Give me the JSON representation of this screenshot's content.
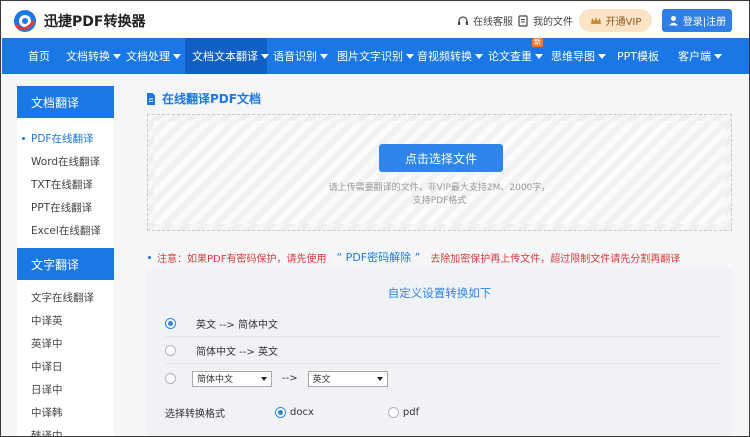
{
  "header": {
    "brand": "迅捷PDF转换器",
    "service_link": "在线客服",
    "files_link": "我的文件",
    "vip_button": "开通VIP",
    "login_button": "登录|注册"
  },
  "nav": {
    "items": [
      {
        "label": "首页",
        "dropdown": false
      },
      {
        "label": "文档转换",
        "dropdown": true
      },
      {
        "label": "文档处理",
        "dropdown": true
      },
      {
        "label": "文档文本翻译",
        "dropdown": true,
        "active": true
      },
      {
        "label": "语音识别",
        "dropdown": true
      },
      {
        "label": "图片文字识别",
        "dropdown": true
      },
      {
        "label": "音视频转换",
        "dropdown": true
      },
      {
        "label": "论文查重",
        "dropdown": true,
        "badge": "新"
      },
      {
        "label": "思维导图",
        "dropdown": true
      },
      {
        "label": "PPT模板",
        "dropdown": false
      },
      {
        "label": "客户端",
        "dropdown": true
      }
    ]
  },
  "sidebar": {
    "section1_title": "文档翻译",
    "section1_items": [
      "PDF在线翻译",
      "Word在线翻译",
      "TXT在线翻译",
      "PPT在线翻译",
      "Excel在线翻译"
    ],
    "section2_title": "文字翻译",
    "section2_items": [
      "文字在线翻译",
      "中译英",
      "英译中",
      "中译日",
      "日译中",
      "中译韩",
      "韩译中"
    ]
  },
  "main": {
    "title": "在线翻译PDF文档",
    "upload_button": "点击选择文件",
    "upload_hint_line1": "请上传需要翻译的文件，非VIP最大支持2M、2000字，",
    "upload_hint_line2": "支持PDF格式",
    "notice_prefix": "注意：如果PDF有密码保护，请先使用",
    "notice_link": "“ PDF密码解除 ”",
    "notice_suffix": "去除加密保护再上传文件，超过限制文件请先分割再翻译",
    "settings_title": "自定义设置转换如下",
    "option1": "英文 --> 简体中文",
    "option2": "简体中文 --> 英文",
    "custom_from": "简体中文",
    "custom_arrow": "-->",
    "custom_to": "英文",
    "format_label": "选择转换格式",
    "format_docx": "docx",
    "format_pdf": "pdf"
  },
  "colors": {
    "primary": "#1a78e6",
    "nav_active": "#0f5fc4",
    "notice_red": "#e23b3b",
    "vip_bg": "#fbe3c6"
  }
}
